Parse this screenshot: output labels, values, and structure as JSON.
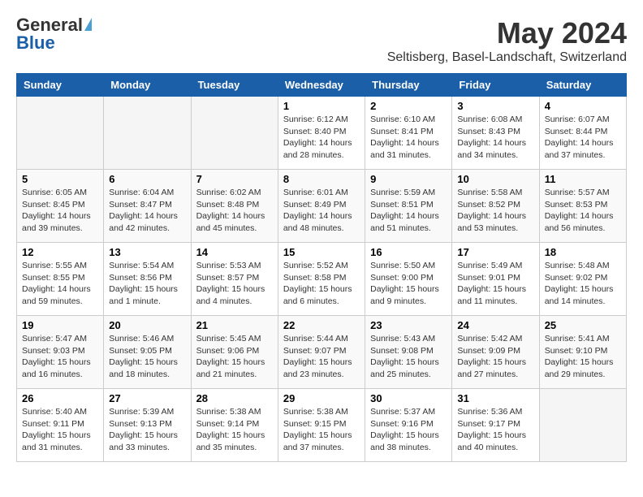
{
  "header": {
    "logo_general": "General",
    "logo_blue": "Blue",
    "month_title": "May 2024",
    "location": "Seltisberg, Basel-Landschaft, Switzerland"
  },
  "days_of_week": [
    "Sunday",
    "Monday",
    "Tuesday",
    "Wednesday",
    "Thursday",
    "Friday",
    "Saturday"
  ],
  "weeks": [
    [
      {
        "day": "",
        "info": ""
      },
      {
        "day": "",
        "info": ""
      },
      {
        "day": "",
        "info": ""
      },
      {
        "day": "1",
        "info": "Sunrise: 6:12 AM\nSunset: 8:40 PM\nDaylight: 14 hours and 28 minutes."
      },
      {
        "day": "2",
        "info": "Sunrise: 6:10 AM\nSunset: 8:41 PM\nDaylight: 14 hours and 31 minutes."
      },
      {
        "day": "3",
        "info": "Sunrise: 6:08 AM\nSunset: 8:43 PM\nDaylight: 14 hours and 34 minutes."
      },
      {
        "day": "4",
        "info": "Sunrise: 6:07 AM\nSunset: 8:44 PM\nDaylight: 14 hours and 37 minutes."
      }
    ],
    [
      {
        "day": "5",
        "info": "Sunrise: 6:05 AM\nSunset: 8:45 PM\nDaylight: 14 hours and 39 minutes."
      },
      {
        "day": "6",
        "info": "Sunrise: 6:04 AM\nSunset: 8:47 PM\nDaylight: 14 hours and 42 minutes."
      },
      {
        "day": "7",
        "info": "Sunrise: 6:02 AM\nSunset: 8:48 PM\nDaylight: 14 hours and 45 minutes."
      },
      {
        "day": "8",
        "info": "Sunrise: 6:01 AM\nSunset: 8:49 PM\nDaylight: 14 hours and 48 minutes."
      },
      {
        "day": "9",
        "info": "Sunrise: 5:59 AM\nSunset: 8:51 PM\nDaylight: 14 hours and 51 minutes."
      },
      {
        "day": "10",
        "info": "Sunrise: 5:58 AM\nSunset: 8:52 PM\nDaylight: 14 hours and 53 minutes."
      },
      {
        "day": "11",
        "info": "Sunrise: 5:57 AM\nSunset: 8:53 PM\nDaylight: 14 hours and 56 minutes."
      }
    ],
    [
      {
        "day": "12",
        "info": "Sunrise: 5:55 AM\nSunset: 8:55 PM\nDaylight: 14 hours and 59 minutes."
      },
      {
        "day": "13",
        "info": "Sunrise: 5:54 AM\nSunset: 8:56 PM\nDaylight: 15 hours and 1 minute."
      },
      {
        "day": "14",
        "info": "Sunrise: 5:53 AM\nSunset: 8:57 PM\nDaylight: 15 hours and 4 minutes."
      },
      {
        "day": "15",
        "info": "Sunrise: 5:52 AM\nSunset: 8:58 PM\nDaylight: 15 hours and 6 minutes."
      },
      {
        "day": "16",
        "info": "Sunrise: 5:50 AM\nSunset: 9:00 PM\nDaylight: 15 hours and 9 minutes."
      },
      {
        "day": "17",
        "info": "Sunrise: 5:49 AM\nSunset: 9:01 PM\nDaylight: 15 hours and 11 minutes."
      },
      {
        "day": "18",
        "info": "Sunrise: 5:48 AM\nSunset: 9:02 PM\nDaylight: 15 hours and 14 minutes."
      }
    ],
    [
      {
        "day": "19",
        "info": "Sunrise: 5:47 AM\nSunset: 9:03 PM\nDaylight: 15 hours and 16 minutes."
      },
      {
        "day": "20",
        "info": "Sunrise: 5:46 AM\nSunset: 9:05 PM\nDaylight: 15 hours and 18 minutes."
      },
      {
        "day": "21",
        "info": "Sunrise: 5:45 AM\nSunset: 9:06 PM\nDaylight: 15 hours and 21 minutes."
      },
      {
        "day": "22",
        "info": "Sunrise: 5:44 AM\nSunset: 9:07 PM\nDaylight: 15 hours and 23 minutes."
      },
      {
        "day": "23",
        "info": "Sunrise: 5:43 AM\nSunset: 9:08 PM\nDaylight: 15 hours and 25 minutes."
      },
      {
        "day": "24",
        "info": "Sunrise: 5:42 AM\nSunset: 9:09 PM\nDaylight: 15 hours and 27 minutes."
      },
      {
        "day": "25",
        "info": "Sunrise: 5:41 AM\nSunset: 9:10 PM\nDaylight: 15 hours and 29 minutes."
      }
    ],
    [
      {
        "day": "26",
        "info": "Sunrise: 5:40 AM\nSunset: 9:11 PM\nDaylight: 15 hours and 31 minutes."
      },
      {
        "day": "27",
        "info": "Sunrise: 5:39 AM\nSunset: 9:13 PM\nDaylight: 15 hours and 33 minutes."
      },
      {
        "day": "28",
        "info": "Sunrise: 5:38 AM\nSunset: 9:14 PM\nDaylight: 15 hours and 35 minutes."
      },
      {
        "day": "29",
        "info": "Sunrise: 5:38 AM\nSunset: 9:15 PM\nDaylight: 15 hours and 37 minutes."
      },
      {
        "day": "30",
        "info": "Sunrise: 5:37 AM\nSunset: 9:16 PM\nDaylight: 15 hours and 38 minutes."
      },
      {
        "day": "31",
        "info": "Sunrise: 5:36 AM\nSunset: 9:17 PM\nDaylight: 15 hours and 40 minutes."
      },
      {
        "day": "",
        "info": ""
      }
    ]
  ]
}
